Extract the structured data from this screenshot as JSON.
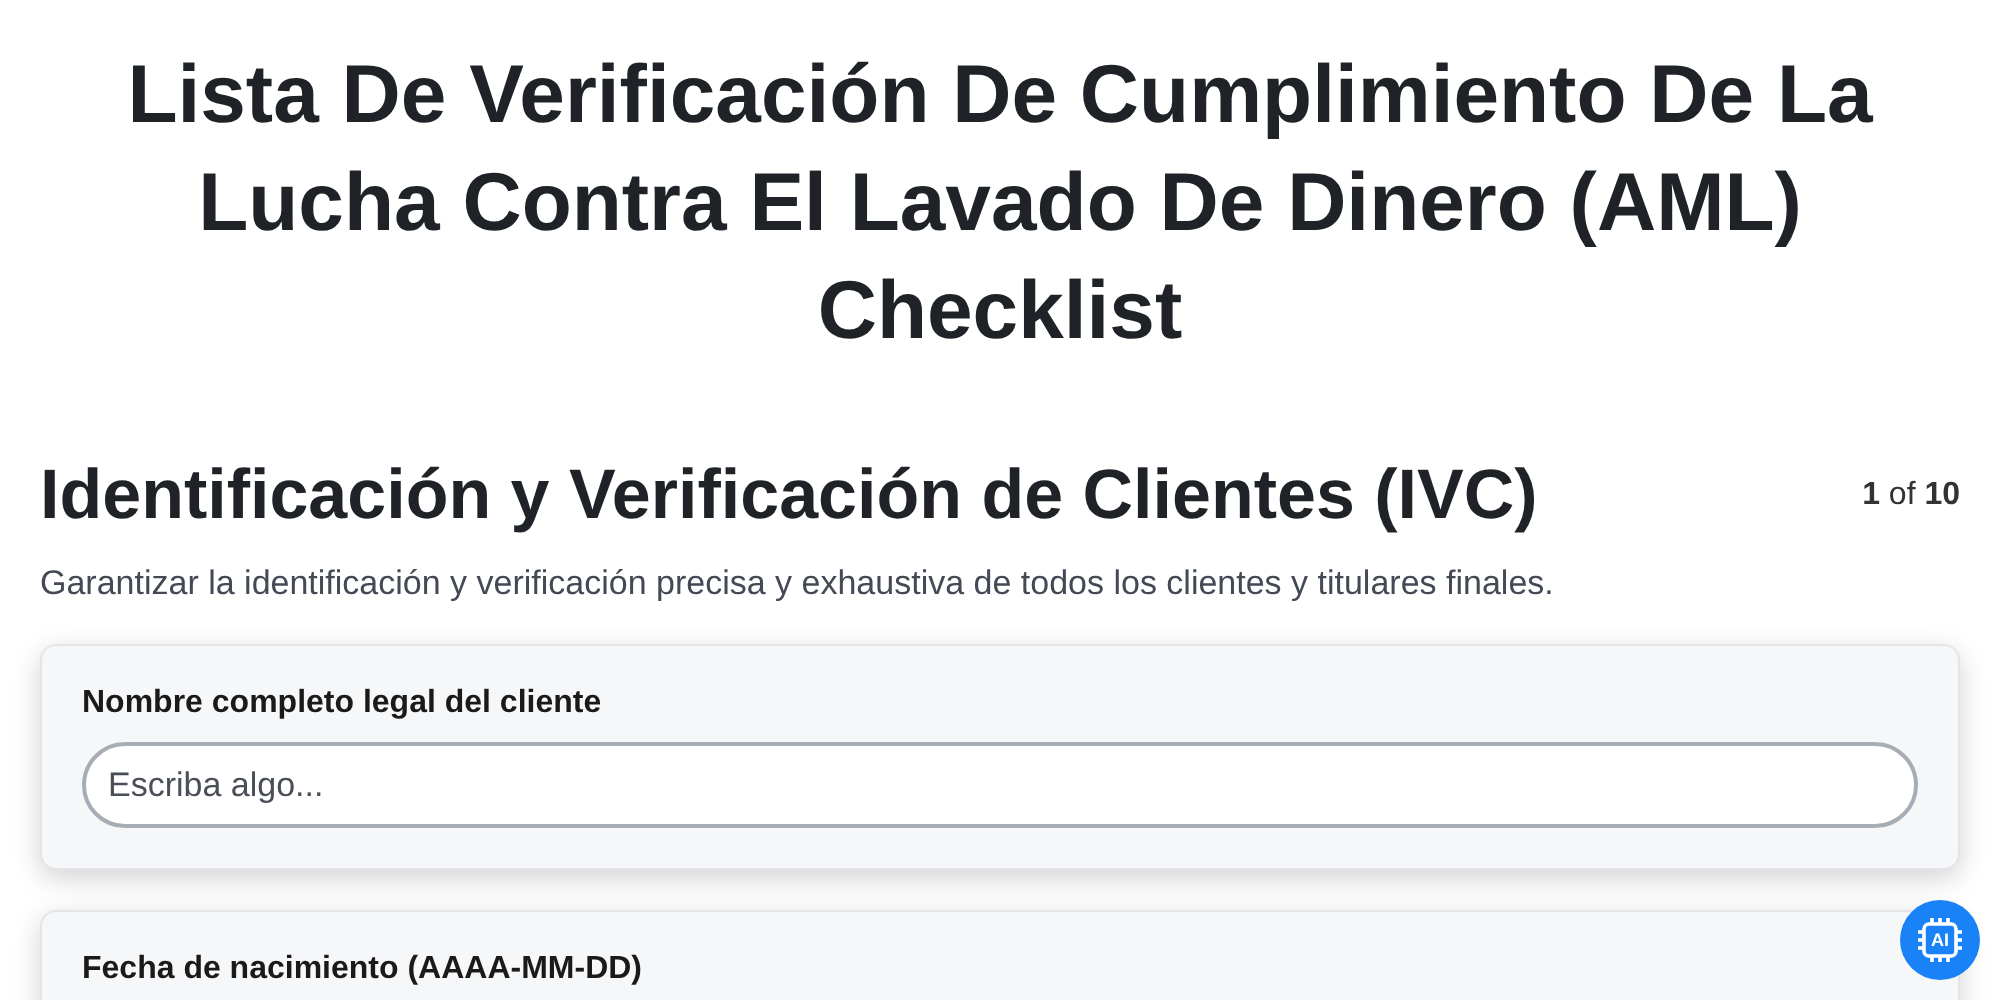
{
  "title": "Lista De Verificación De Cumplimiento De La Lucha Contra El Lavado De Dinero (AML) Checklist",
  "section": {
    "heading": "Identificación y Verificación de Clientes (IVC)",
    "page_current": "1",
    "page_of": "of",
    "page_total": "10",
    "description": "Garantizar la identificación y verificación precisa y exhaustiva de todos los clientes y titulares finales."
  },
  "fields": [
    {
      "label": "Nombre completo legal del cliente",
      "placeholder": "Escriba algo..."
    },
    {
      "label": "Fecha de nacimiento (AAAA-MM-DD)"
    }
  ],
  "ai_button": {
    "label": "AI"
  }
}
